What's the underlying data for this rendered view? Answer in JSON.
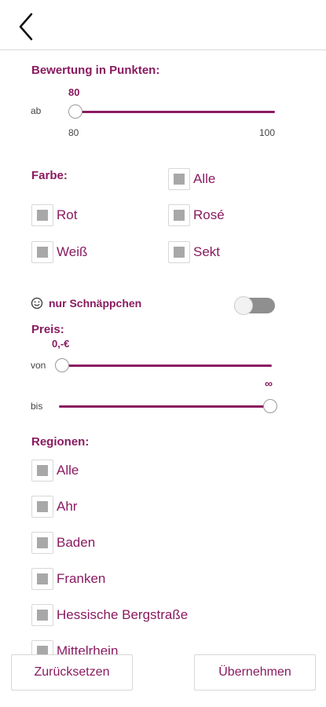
{
  "rating": {
    "heading": "Bewertung in Punkten:",
    "current_value": "80",
    "prefix": "ab",
    "min_label": "80",
    "max_label": "100",
    "slider_fraction": 0
  },
  "colors": {
    "heading": "Farbe:",
    "items": [
      {
        "label": "Alle"
      },
      {
        "label": "Rot"
      },
      {
        "label": "Rosé"
      },
      {
        "label": "Weiß"
      },
      {
        "label": "Sekt"
      }
    ]
  },
  "bargain": {
    "label": "nur Schnäppchen",
    "enabled": false
  },
  "price": {
    "heading": "Preis:",
    "from_value": "0,-€",
    "to_value": "∞",
    "from_label": "von",
    "to_label": "bis",
    "from_fraction": 0,
    "to_fraction": 1
  },
  "regions": {
    "heading": "Regionen:",
    "items": [
      {
        "label": "Alle"
      },
      {
        "label": "Ahr"
      },
      {
        "label": "Baden"
      },
      {
        "label": "Franken"
      },
      {
        "label": "Hessische Bergstraße"
      },
      {
        "label": "Mittelrhein"
      }
    ]
  },
  "footer": {
    "reset_label": "Zurücksetzen",
    "apply_label": "Übernehmen"
  },
  "theme": {
    "accent": "#8a1a60",
    "toggle_off": "#8f8f8f"
  }
}
